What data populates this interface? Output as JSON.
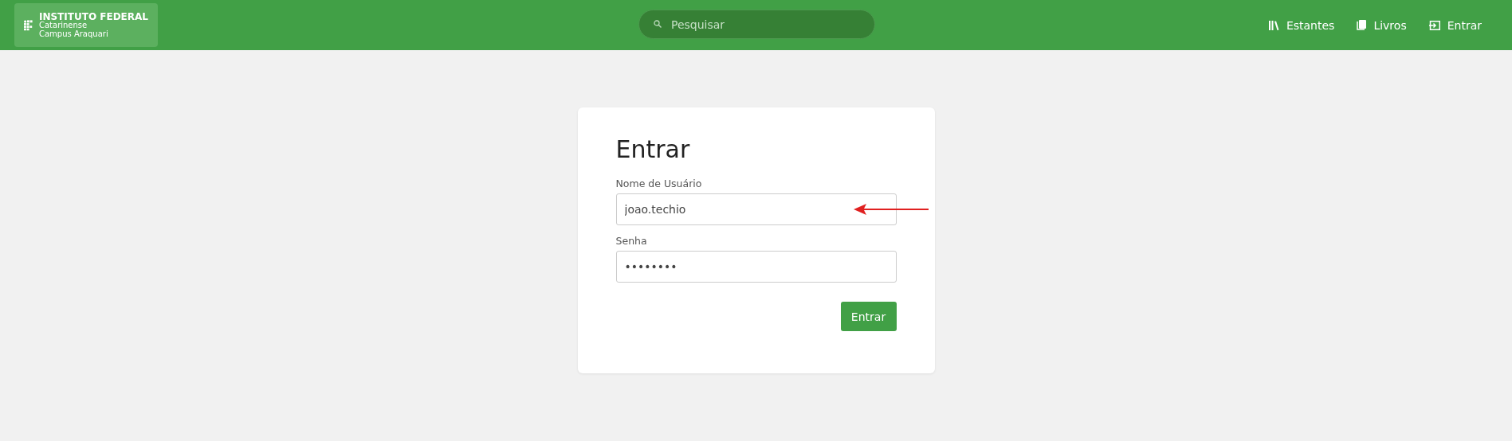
{
  "header": {
    "logo": {
      "title": "INSTITUTO FEDERAL",
      "lines": [
        "Catarinense",
        "Campus Araquari"
      ]
    },
    "search": {
      "placeholder": "Pesquisar"
    },
    "nav": [
      {
        "label": "Estantes",
        "kind": "shelves"
      },
      {
        "label": "Livros",
        "kind": "book"
      },
      {
        "label": "Entrar",
        "kind": "login"
      }
    ]
  },
  "login": {
    "title": "Entrar",
    "fields": [
      {
        "label": "Nome de Usuário",
        "value": "joao.techio",
        "annotated": true
      },
      {
        "label": "Senha",
        "value": "••••••••",
        "annotated": false
      }
    ],
    "button": "Entrar"
  }
}
